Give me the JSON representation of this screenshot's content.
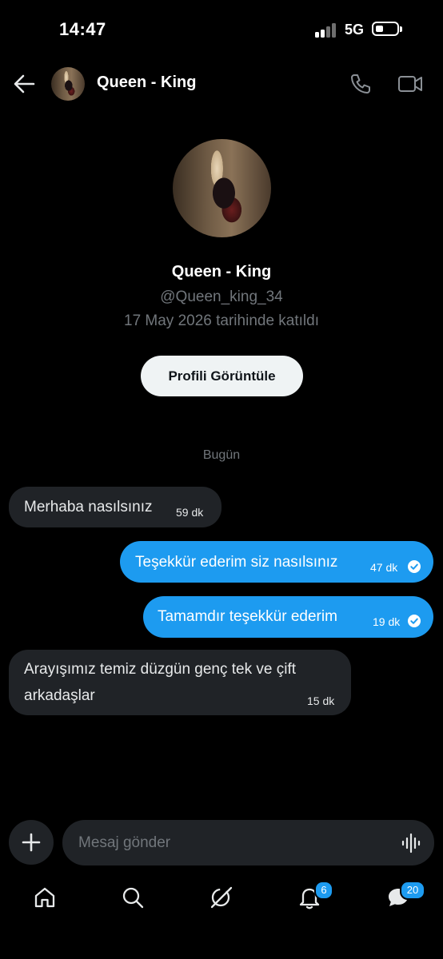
{
  "status_bar": {
    "time": "14:47",
    "network": "5G"
  },
  "header": {
    "title": "Queen - King"
  },
  "profile": {
    "name": "Queen - King",
    "handle": "@Queen_king_34",
    "joined": "17 May 2026 tarihinde katıldı",
    "view_button": "Profili Görüntüle"
  },
  "date_divider": "Bugün",
  "messages": [
    {
      "direction": "incoming",
      "text": "Merhaba nasılsınız",
      "time": "59 dk"
    },
    {
      "direction": "outgoing",
      "text": "Teşekkür ederim siz nasılsınız",
      "time": "47 dk",
      "read": true
    },
    {
      "direction": "outgoing",
      "text": "Tamamdır teşekkür ederim",
      "time": "19 dk",
      "read": true
    },
    {
      "direction": "incoming",
      "text_line1": "Arayışımız temiz düzgün genç tek ve çift",
      "text_line2": "arkadaşlar",
      "time": "15 dk"
    }
  ],
  "composer": {
    "placeholder": "Mesaj gönder"
  },
  "tabbar": {
    "items": [
      "home-icon",
      "search-icon",
      "grok-icon",
      "notifications-icon",
      "messages-icon"
    ],
    "notifications_badge": "6",
    "messages_badge": "20"
  },
  "colors": {
    "accent": "#1d9bf0",
    "incoming_bubble": "#202327",
    "muted_text": "#71767b"
  }
}
